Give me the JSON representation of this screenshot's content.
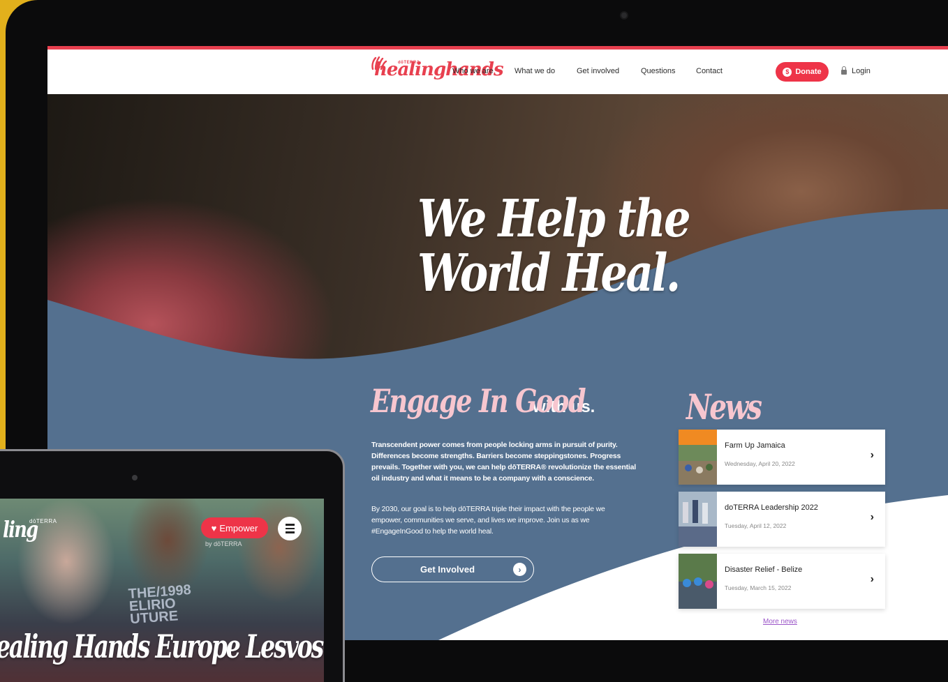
{
  "brand": {
    "name": "healinghands",
    "small": "dōTERRA",
    "sub": "hands",
    "color": "#e8404f"
  },
  "nav": {
    "links": [
      "Who we are",
      "What we do",
      "Get involved",
      "Questions",
      "Contact"
    ],
    "donate_label": "Donate",
    "donate_icon": "$",
    "login_label": "Login"
  },
  "hero": {
    "headline_line1": "We Help the",
    "headline_line2": "World Heal.",
    "wave_color": "#54708f"
  },
  "engage": {
    "script": "Engage In Good",
    "plain": "with us.",
    "para1": "Transcendent power comes from people locking arms in pursuit of purity. Differences become strengths. Barriers become steppingstones. Progress prevails. Together with you, we can help dōTERRA® revolutionize the essential oil industry and what it means to be a company with a conscience.",
    "para2": "By 2030, our goal is to help dōTERRA triple their impact with the people we empower, communities we serve, and lives we improve. Join us as we #EngageInGood to help the world heal.",
    "cta_label": "Get Involved",
    "cta_icon": "›"
  },
  "news": {
    "title": "News",
    "items": [
      {
        "title": "Farm Up Jamaica",
        "date": "Wednesday, April 20, 2022"
      },
      {
        "title": "doTERRA Leadership 2022",
        "date": "Tuesday, April 12, 2022"
      },
      {
        "title": "Disaster Relief - Belize",
        "date": "Tuesday, March 15, 2022"
      }
    ],
    "more_label": "More news",
    "chevron": "›"
  },
  "tablet": {
    "logo": "ling",
    "logo_small": "dōTERRA",
    "logo_sub": "hands",
    "empower_label": "Empower",
    "empower_icon": "♥",
    "caption": "by dōTERRA",
    "shirt_text": "THE/1998\nELIRIO\nUTURE",
    "headline": "ealing Hands Europe Lesvos"
  }
}
